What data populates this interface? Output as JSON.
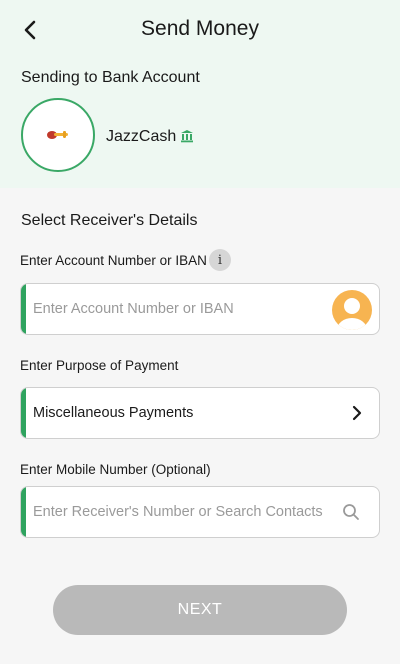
{
  "header": {
    "title": "Send Money",
    "back_icon": "chevron-left-icon"
  },
  "sending": {
    "heading": "Sending to Bank Account",
    "bank_name": "JazzCash",
    "bank_icon": "bank-building-icon",
    "accent_color": "#3aa866"
  },
  "receiver": {
    "heading": "Select Receiver's Details",
    "account": {
      "label": "Enter Account Number or IBAN",
      "info_icon_text": "i",
      "placeholder": "Enter Account Number or IBAN",
      "value": ""
    },
    "purpose": {
      "label": "Enter Purpose of Payment",
      "value": "Miscellaneous Payments"
    },
    "mobile": {
      "label": "Enter Mobile Number (Optional)",
      "placeholder": "Enter Receiver's Number or Search Contacts",
      "value": ""
    }
  },
  "actions": {
    "next_label": "NEXT"
  }
}
